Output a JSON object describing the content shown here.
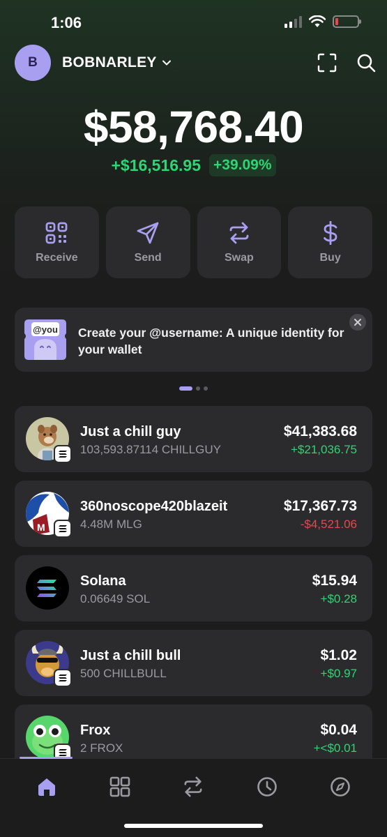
{
  "status_bar": {
    "time": "1:06"
  },
  "header": {
    "avatar_letter": "B",
    "account_name": "BOBNARLEY"
  },
  "balance": {
    "total": "$58,768.40",
    "change_abs": "+$16,516.95",
    "change_pct": "+39.09%"
  },
  "actions": [
    {
      "label": "Receive",
      "icon": "qr-code-icon"
    },
    {
      "label": "Send",
      "icon": "send-icon"
    },
    {
      "label": "Swap",
      "icon": "swap-icon"
    },
    {
      "label": "Buy",
      "icon": "dollar-icon"
    }
  ],
  "banner": {
    "image_text": "@you",
    "text": "Create your @username: A unique identity for your wallet"
  },
  "tokens": [
    {
      "name": "Just a chill guy",
      "amount": "103,593.87114 CHILLGUY",
      "value": "$41,383.68",
      "change": "+$21,036.75",
      "change_dir": "pos"
    },
    {
      "name": "360noscope420blazeit",
      "amount": "4.48M MLG",
      "value": "$17,367.73",
      "change": "-$4,521.06",
      "change_dir": "neg"
    },
    {
      "name": "Solana",
      "amount": "0.06649 SOL",
      "value": "$15.94",
      "change": "+$0.28",
      "change_dir": "pos"
    },
    {
      "name": "Just a chill bull",
      "amount": "500 CHILLBULL",
      "value": "$1.02",
      "change": "+$0.97",
      "change_dir": "pos"
    },
    {
      "name": "Frox",
      "amount": "2 FROX",
      "value": "$0.04",
      "change": "+<$0.01",
      "change_dir": "pos"
    }
  ],
  "nav": [
    {
      "name": "home",
      "icon": "home-icon",
      "active": true
    },
    {
      "name": "collectibles",
      "icon": "grid-icon",
      "active": false
    },
    {
      "name": "swap",
      "icon": "swap-icon",
      "active": false
    },
    {
      "name": "activity",
      "icon": "clock-icon",
      "active": false
    },
    {
      "name": "explore",
      "icon": "compass-icon",
      "active": false
    }
  ],
  "colors": {
    "accent": "#a99ff0",
    "positive": "#2ed573",
    "negative": "#e5484d",
    "card": "#2b2b2e",
    "background": "#1c1c1c"
  }
}
